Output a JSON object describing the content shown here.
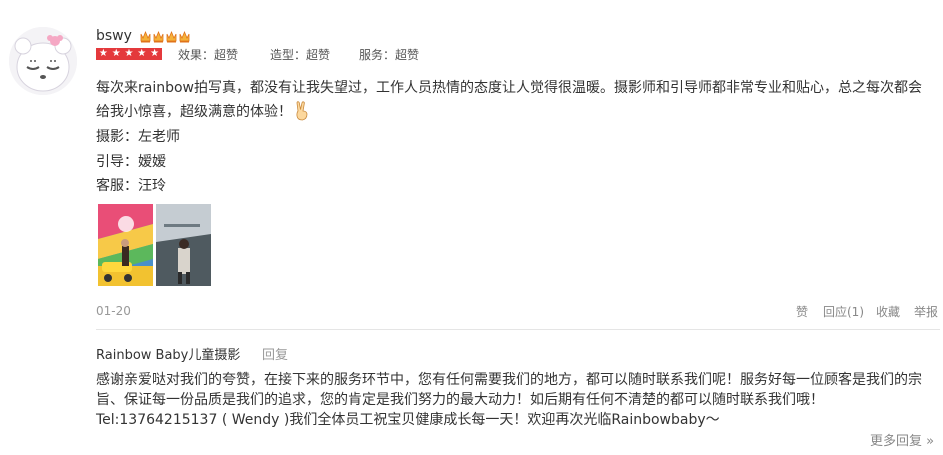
{
  "review": {
    "username": "bswy",
    "ratings": [
      {
        "label": "效果：超赞"
      },
      {
        "label": "造型：超赞"
      },
      {
        "label": "服务：超赞"
      }
    ],
    "text": "每次来rainbow拍写真，都没有让我失望过，工作人员热情的态度让人觉得很温暖。摄影师和引导师都非常专业和贴心，总之每次都会给我小惊喜，超级满意的体验！",
    "photographer": "摄影：左老师",
    "guide": "引导：嫒嫒",
    "service": "客服：汪玲",
    "date": "01-20"
  },
  "actions": {
    "like": "赞",
    "reply": "回应(1)",
    "favorite": "收藏",
    "report": "举报"
  },
  "merchant_reply": {
    "author": "Rainbow Baby儿童摄影",
    "tag": "回复",
    "text": "感谢亲爱哒对我们的夸赞，在接下来的服务环节中，您有任何需要我们的地方，都可以随时联系我们呢！服务好每一位顾客是我们的宗旨、保证每一份品质是我们的追求，您的肯定是我们努力的最大动力！如后期有任何不清楚的都可以随时联系我们哦！Tel:13764215137 ( Wendy )我们全体员工祝宝贝健康成长每一天！欢迎再次光临Rainbowbaby～"
  },
  "more_replies": "更多回复 »",
  "colors": {
    "star_bg": "#e4393c",
    "crown": "#f08a1c"
  },
  "icons": {
    "avatar": "cartoon-face",
    "crown": "crown-icon",
    "star": "star-icon",
    "hand": "victory-hand-emoji"
  }
}
